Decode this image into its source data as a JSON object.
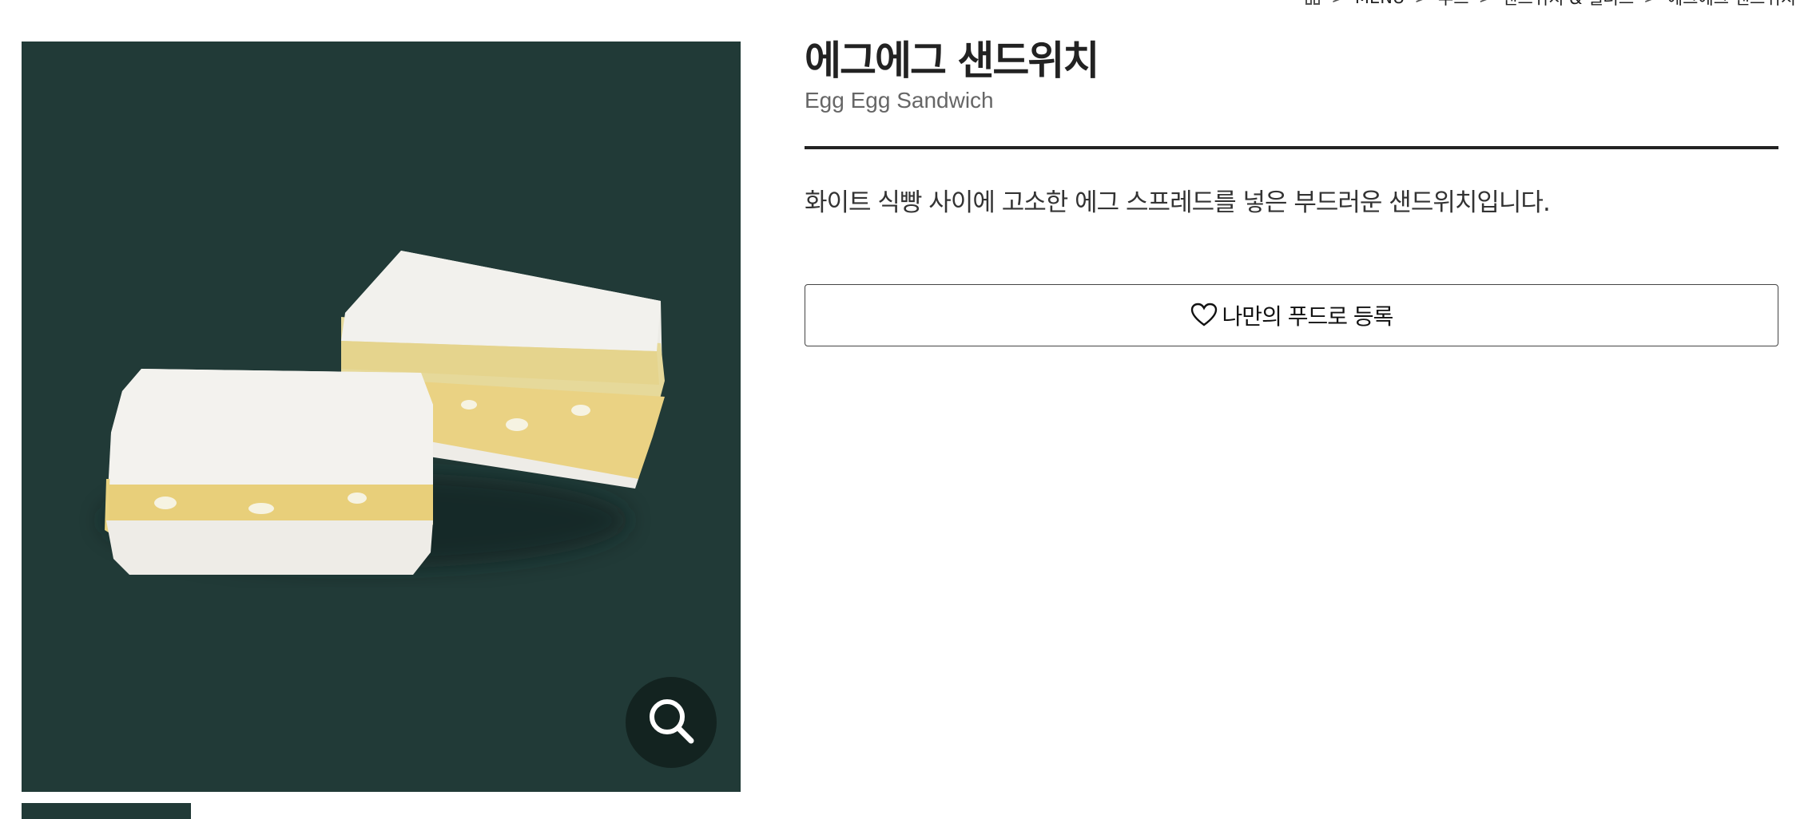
{
  "breadcrumb": {
    "items": [
      "MENU",
      "푸드",
      "샌드위치 & 샐러드",
      "에그에그 샌드위치"
    ],
    "separator": ">"
  },
  "product": {
    "name_ko": "에그에그 샌드위치",
    "name_en": "Egg Egg Sandwich",
    "description": "화이트 식빵 사이에 고소한 에그 스프레드를 넣은 부드러운 샌드위치입니다.",
    "register_button_label": "나만의 푸드로 등록"
  },
  "icons": {
    "breadcrumb_home": "home-icon",
    "zoom": "magnifier-icon",
    "register": "heart-outline-icon"
  },
  "colors": {
    "image_background": "#213a37",
    "zoom_button": "#132320",
    "divider": "#222222"
  }
}
